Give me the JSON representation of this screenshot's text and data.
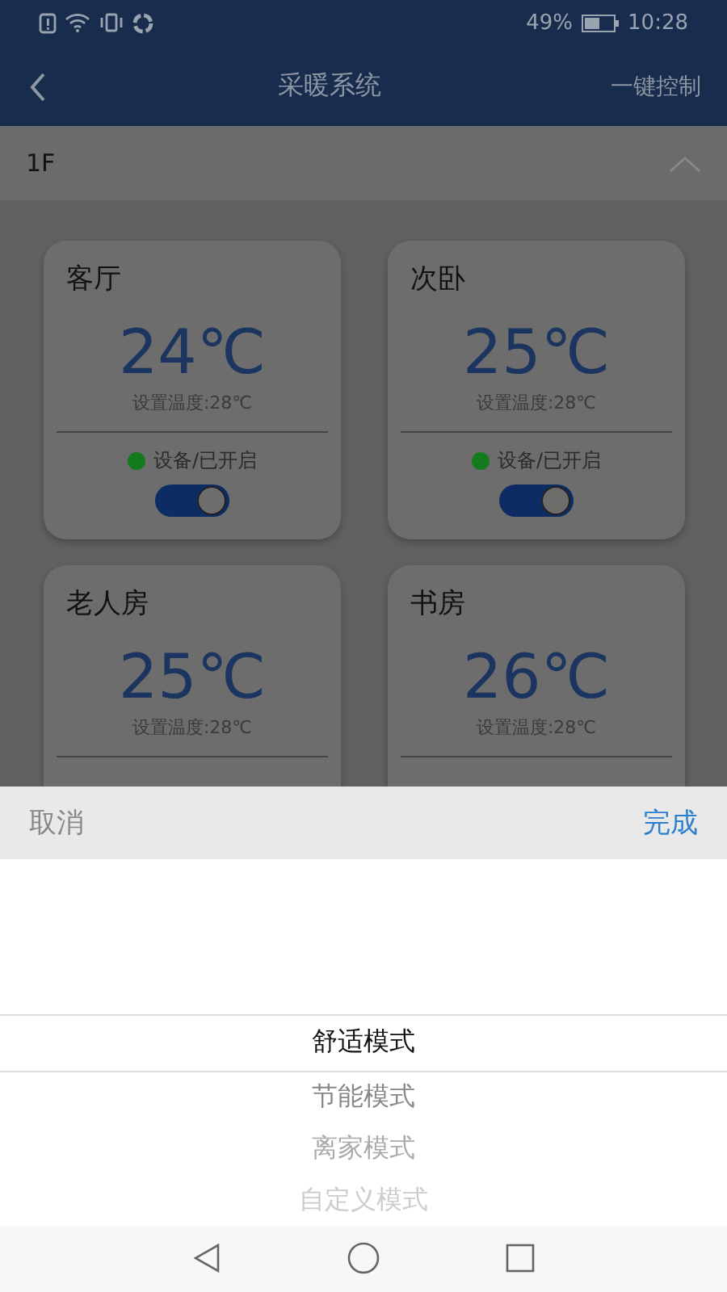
{
  "status_bar": {
    "battery": "49%",
    "time": "10:28"
  },
  "header": {
    "title": "采暖系统",
    "action": "一键控制"
  },
  "floor": {
    "label": "1F",
    "expanded": true
  },
  "rooms": [
    {
      "name": "客厅",
      "temperature": "24℃",
      "setpoint": "设置温度:28℃",
      "status": "设备/已开启",
      "on": true
    },
    {
      "name": "次卧",
      "temperature": "25℃",
      "setpoint": "设置温度:28℃",
      "status": "设备/已开启",
      "on": true
    },
    {
      "name": "老人房",
      "temperature": "25℃",
      "setpoint": "设置温度:28℃"
    },
    {
      "name": "书房",
      "temperature": "26℃",
      "setpoint": "设置温度:28℃"
    }
  ],
  "sheet": {
    "cancel": "取消",
    "confirm": "完成",
    "options": [
      {
        "label": "舒适模式",
        "selected": true
      },
      {
        "label": "节能模式",
        "selected": false
      },
      {
        "label": "离家模式",
        "selected": false
      },
      {
        "label": "自定义模式",
        "selected": false
      }
    ]
  }
}
